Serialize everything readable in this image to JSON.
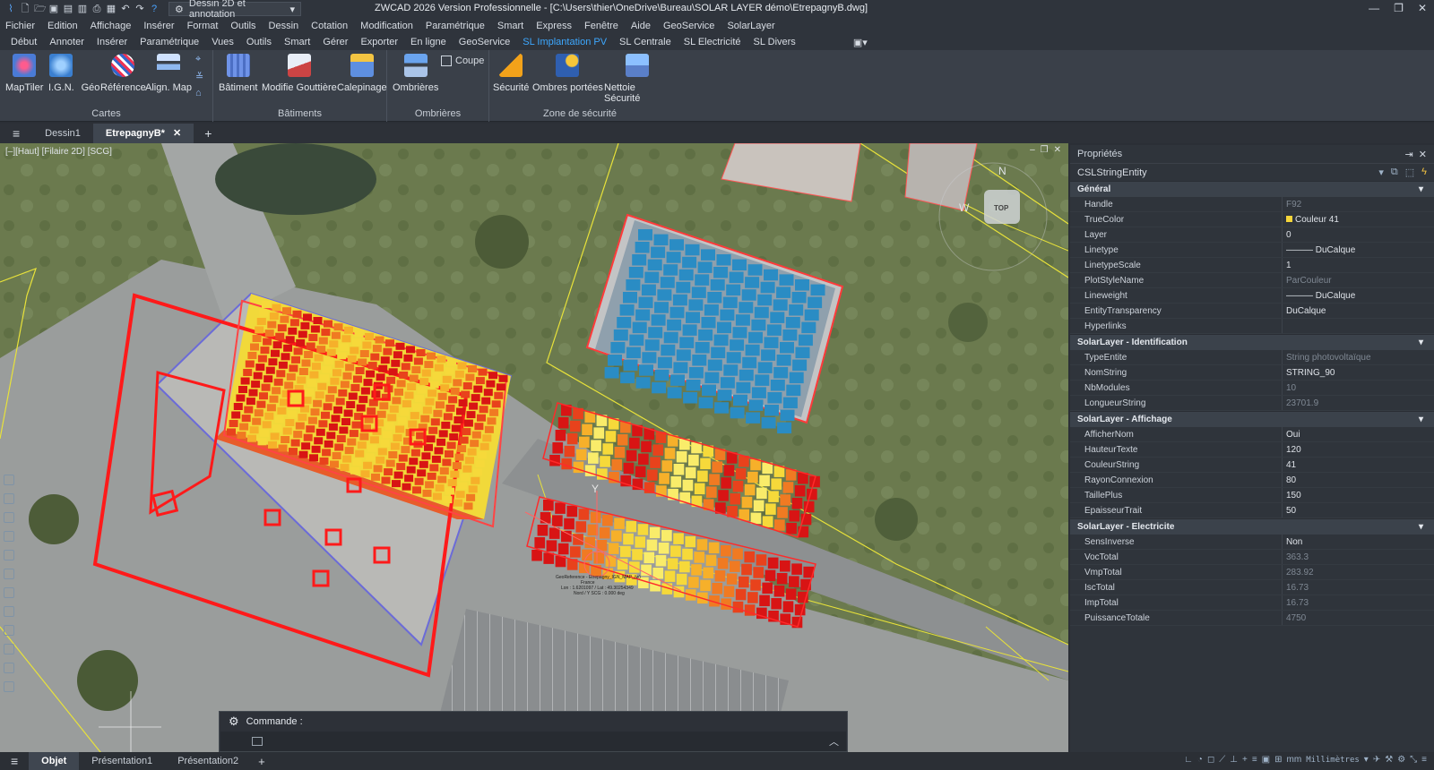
{
  "window": {
    "title": "ZWCAD 2026 Version Professionnelle - [C:\\Users\\thier\\OneDrive\\Bureau\\SOLAR LAYER démo\\EtrepagnyB.dwg]",
    "workspace": "Dessin 2D et annotation",
    "controls": [
      "—",
      "❐",
      "✕"
    ]
  },
  "menu": [
    "Fichier",
    "Edition",
    "Affichage",
    "Insérer",
    "Format",
    "Outils",
    "Dessin",
    "Cotation",
    "Modification",
    "Paramétrique",
    "Smart",
    "Express",
    "Fenêtre",
    "Aide",
    "GeoService",
    "SolarLayer"
  ],
  "ribbon_tabs": [
    "Début",
    "Annoter",
    "Insérer",
    "Paramétrique",
    "Vues",
    "Outils",
    "Smart",
    "Gérer",
    "Exporter",
    "En ligne",
    "GeoService",
    "SL Implantation PV",
    "SL Centrale",
    "SL Electricité",
    "SL Divers"
  ],
  "ribbon_active_tab": "SL Implantation PV",
  "ribbon_groups": {
    "cartes": {
      "title": "Cartes",
      "buttons": [
        "MapTiler",
        "I.G.N.",
        "Géo",
        "Référence",
        "Align. Map"
      ]
    },
    "batiments": {
      "title": "Bâtiments",
      "buttons": [
        "Bâtiment",
        "Modifie Gouttière",
        "Calepinage"
      ]
    },
    "ombrieres": {
      "title": "Ombrières",
      "buttons": [
        "Ombrières"
      ],
      "coupe": "Coupe"
    },
    "securite": {
      "title": "Zone de sécurité",
      "buttons": [
        "Sécurité",
        "Ombres portées",
        "Nettoie Sécurité"
      ]
    }
  },
  "doc_tabs": [
    "Dessin1",
    "EtrepagnyB*"
  ],
  "doc_tab_add": "+",
  "viewport": {
    "label": "[–][Haut] [Filaire 2D] [SCG]",
    "viewcube": "TOP",
    "compass_n": "N",
    "compass_w": "W",
    "ucs_y": "Y",
    "georef_text": [
      "GeoReference - Etrepagny_IGN_MAP_(w)",
      "France",
      "Lon : 1.6201097 / Lat : 49.30254349",
      "Nord / Y SCG : 0.000 deg"
    ]
  },
  "command": {
    "label": "Commande :",
    "value": ""
  },
  "properties": {
    "title": "Propriétés",
    "entity": "CSLStringEntity",
    "sections": [
      {
        "name": "Général",
        "rows": [
          {
            "k": "Handle",
            "v": "F92",
            "dim": true
          },
          {
            "k": "TrueColor",
            "v": "Couleur 41",
            "swatch": "#f5d53a"
          },
          {
            "k": "Layer",
            "v": "0"
          },
          {
            "k": "Linetype",
            "v": "——— DuCalque"
          },
          {
            "k": "LinetypeScale",
            "v": "1"
          },
          {
            "k": "PlotStyleName",
            "v": "ParCouleur",
            "dim": true
          },
          {
            "k": "Lineweight",
            "v": "——— DuCalque"
          },
          {
            "k": "EntityTransparency",
            "v": "DuCalque"
          },
          {
            "k": "Hyperlinks",
            "v": ""
          }
        ]
      },
      {
        "name": "SolarLayer - Identification",
        "rows": [
          {
            "k": "TypeEntite",
            "v": "String photovoltaïque",
            "dim": true
          },
          {
            "k": "NomString",
            "v": "STRING_90"
          },
          {
            "k": "NbModules",
            "v": "10",
            "dim": true
          },
          {
            "k": "LongueurString",
            "v": "23701.9",
            "dim": true
          }
        ]
      },
      {
        "name": "SolarLayer - Affichage",
        "rows": [
          {
            "k": "AfficherNom",
            "v": "Oui"
          },
          {
            "k": "HauteurTexte",
            "v": "120"
          },
          {
            "k": "CouleurString",
            "v": "41"
          },
          {
            "k": "RayonConnexion",
            "v": "80"
          },
          {
            "k": "TaillePlus",
            "v": "150"
          },
          {
            "k": "EpaisseurTrait",
            "v": "50"
          }
        ]
      },
      {
        "name": "SolarLayer - Electricite",
        "rows": [
          {
            "k": "SensInverse",
            "v": "Non"
          },
          {
            "k": "VocTotal",
            "v": "363.3",
            "dim": true
          },
          {
            "k": "VmpTotal",
            "v": "283.92",
            "dim": true
          },
          {
            "k": "IscTotal",
            "v": "16.73",
            "dim": true
          },
          {
            "k": "ImpTotal",
            "v": "16.73",
            "dim": true
          },
          {
            "k": "PuissanceTotale",
            "v": "4750",
            "dim": true
          }
        ]
      }
    ]
  },
  "status": {
    "tabs": [
      "Objet",
      "Présentation1",
      "Présentation2"
    ],
    "units": "Millimètres"
  },
  "colors": {
    "accent": "#3da8ff",
    "selection_red": "#ff1a1a",
    "parcel_yellow": "#e8e23a"
  }
}
